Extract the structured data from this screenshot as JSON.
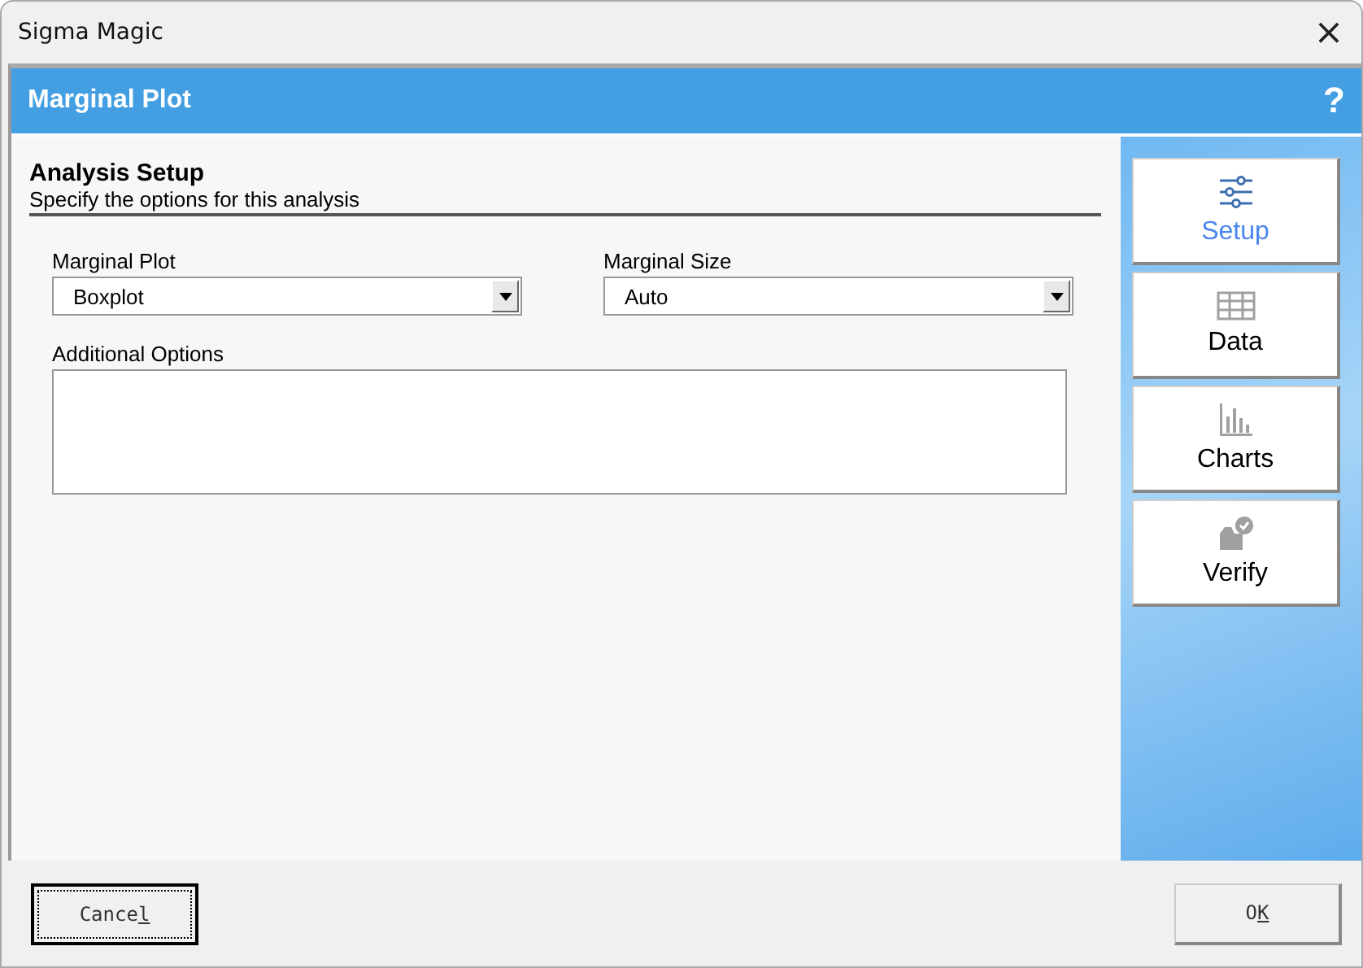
{
  "window": {
    "title": "Sigma Magic",
    "close": "×"
  },
  "header": {
    "title": "Marginal Plot",
    "help": "?"
  },
  "section": {
    "title": "Analysis Setup",
    "subtitle": "Specify the options for this analysis"
  },
  "fields": [
    {
      "label": "Marginal Plot",
      "value": "Boxplot"
    },
    {
      "label": "Marginal Size",
      "value": "Auto"
    }
  ],
  "options": {
    "label": "Additional Options"
  },
  "nav": [
    {
      "label": "Setup",
      "kind": "setup",
      "selected": true
    },
    {
      "label": "Data",
      "kind": "data",
      "selected": false
    },
    {
      "label": "Charts",
      "kind": "charts",
      "selected": false
    },
    {
      "label": "Verify",
      "kind": "verify",
      "selected": false
    }
  ],
  "buttons": [
    {
      "label": "Cance",
      "access_key": "l",
      "focused": true
    },
    {
      "label": "O",
      "access_key": "K",
      "focused": false
    }
  ]
}
